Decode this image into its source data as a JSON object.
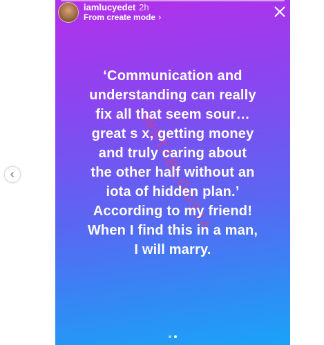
{
  "story": {
    "username": "iamlucyedet",
    "time": "2h",
    "mode_link": "From create mode",
    "quote": "‘Communication and\nunderstanding can really\nfix all that seem sour…\ngreat s  x, getting money\nand truly caring about\nthe other half without an\niota of hidden plan.’\nAccording to my friend!\nWhen I find this in a man,\nI will marry.",
    "watermark": "INSTABLOG9JA",
    "gradient_colors": [
      "#b42fea",
      "#8847f0",
      "#5a66f2",
      "#2f8df5",
      "#1aa3f7"
    ]
  },
  "icons": {
    "prev": "chevron-left-icon",
    "close": "close-icon",
    "mode_chevron": "chevron-right-icon"
  },
  "pagination": {
    "count": 2,
    "active_index": 1
  }
}
